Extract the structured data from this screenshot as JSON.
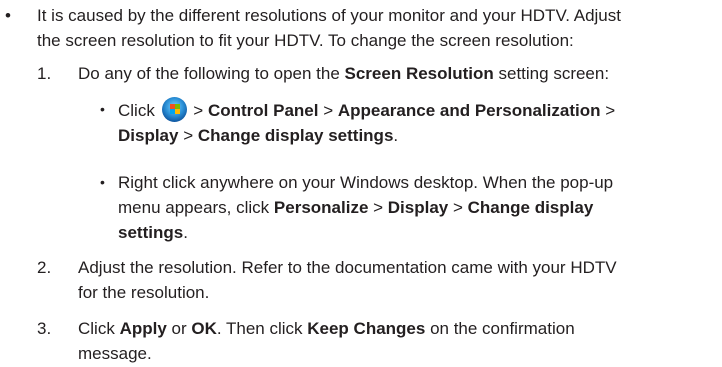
{
  "bullet": {
    "symbol": "•",
    "text_line1": "It is caused by the different resolutions of your monitor and your HDTV. Adjust",
    "text_line2": "the screen resolution to fit your HDTV. To change the screen resolution:"
  },
  "steps": [
    {
      "number": "1.",
      "pre": "Do any of the following to open the ",
      "bold": "Screen Resolution",
      "post": " setting screen:"
    },
    {
      "number": "2.",
      "line1": "Adjust the resolution. Refer to the documentation came with your HDTV",
      "line2": "for the resolution."
    },
    {
      "number": "3.",
      "pre": "Click ",
      "b1": "Apply",
      "mid1": " or ",
      "b2": "OK",
      "mid2": ". Then click ",
      "b3": "Keep Changes",
      "post": " on the confirmation",
      "line2": "message."
    }
  ],
  "sub_items": [
    {
      "symbol": "•",
      "click": "Click",
      "sep": " > ",
      "b_control_panel": "Control Panel",
      "b_appearance": "Appearance and Personalization",
      "b_display": "Display",
      "b_change": "Change display settings",
      "end": "."
    },
    {
      "symbol": "•",
      "line1": "Right click anywhere on your Windows desktop. When the pop-up",
      "line2_pre": "menu appears, click ",
      "b_personalize": "Personalize",
      "b_display": "Display",
      "b_change_part1": "Change display",
      "b_change_part2": "settings",
      "end": "."
    }
  ],
  "icons": {
    "start_orb": "windows-start-orb-icon"
  }
}
